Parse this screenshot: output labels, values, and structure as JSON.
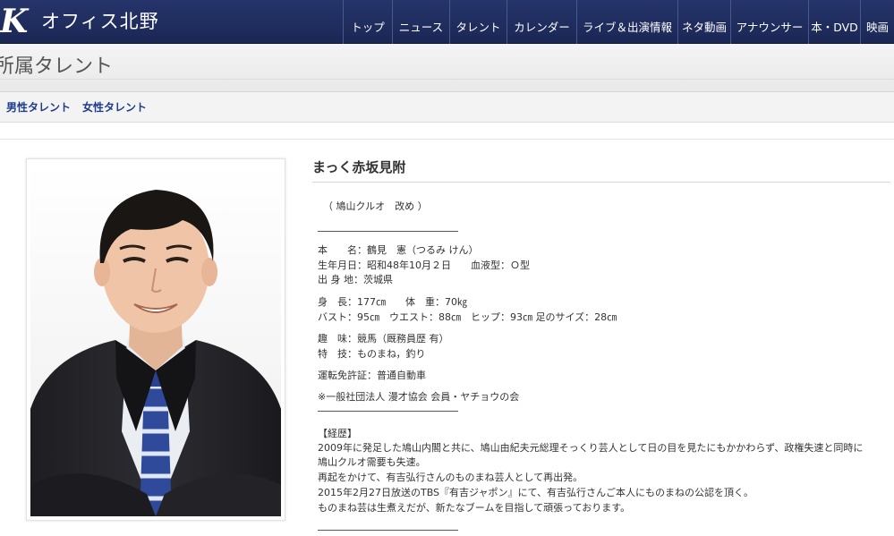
{
  "header": {
    "logo_mark": "K",
    "logo_text": "オフィス北野",
    "nav": [
      "トップ",
      "ニュース",
      "タレント",
      "カレンダー",
      "ライブ＆出演情報",
      "ネタ動画",
      "アナウンサー",
      "本・DVD",
      "映画"
    ]
  },
  "page_title": "所属タレント",
  "subnav": [
    "男性タレント",
    "女性タレント"
  ],
  "profile": {
    "name": "まっく赤坂見附",
    "alias": "（ 鳩山クルオ　改め ）",
    "real_name": "本　　名：鶴見　憲（つるみ けん）",
    "birth": "生年月日：昭和48年10月２日　　血液型：Ｏ型",
    "birthplace": "出 身 地：茨城県",
    "height_weight": "身　長：177㎝　　体　重：70㎏",
    "measurements": "バスト：95㎝　ウエスト：88㎝　ヒップ：93㎝ 足のサイズ：28㎝",
    "hobby": "趣　味：競馬（厩務員歴 有）",
    "skill": "特　技：ものまね，釣り",
    "license": "運転免許証：普通自動車",
    "association": "※一般社団法人 漫才協会 会員・ヤチョウの会",
    "career_heading": "【経歴】",
    "career": [
      "2009年に発足した鳩山内閣と共に、鳩山由紀夫元総理そっくり芸人として日の目を見たにもかかわらず、政権失速と同時に",
      "鳩山クルオ需要も失速。",
      "再起をかけて、有吉弘行さんのものまね芸人として再出発。",
      "2015年2月27日放送のTBS『有吉ジャポン』にて、有吉弘行さんご本人にものまねの公認を頂く。",
      "ものまね芸は生煮えだが、新たなブームを目指して頑張っております。"
    ]
  },
  "colors": {
    "header_bg": "#1f2c5e",
    "subnav_link": "#1f3c8a"
  }
}
